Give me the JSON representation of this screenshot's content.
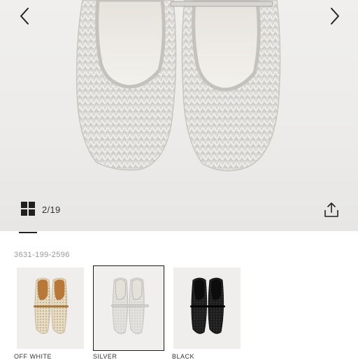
{
  "gallery": {
    "counter": "2/19",
    "prev_icon": "chevron-left-icon",
    "next_icon": "chevron-right-icon",
    "grid_icon": "grid-view-icon",
    "share_icon": "share-icon"
  },
  "product": {
    "sku": "3631-199-2596"
  },
  "variants": [
    {
      "label": "OFF WHITE",
      "selected": false
    },
    {
      "label": "SILVER",
      "selected": true
    },
    {
      "label": "BLACK",
      "selected": false
    }
  ]
}
